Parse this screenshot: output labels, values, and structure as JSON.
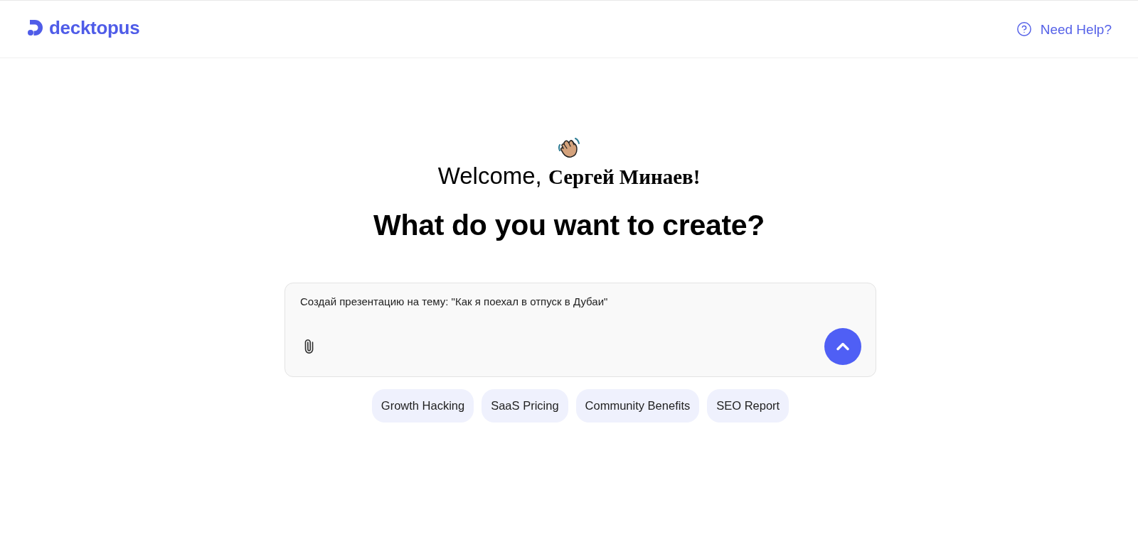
{
  "header": {
    "logo": {
      "text": "decktopus"
    },
    "help_link": {
      "label": "Need Help?"
    }
  },
  "welcome": {
    "greeting": "Welcome, **Сергей Минаев!**"
  },
  "heading": "What do you want to create?",
  "prompt": {
    "value": "Создай презентацию на тему: \"Как я поехал в отпуск в Дубаи\""
  },
  "suggestions": [
    {
      "label": "Growth Hacking"
    },
    {
      "label": "SaaS Pricing"
    },
    {
      "label": "Community Benefits"
    },
    {
      "label": "SEO Report"
    }
  ]
}
